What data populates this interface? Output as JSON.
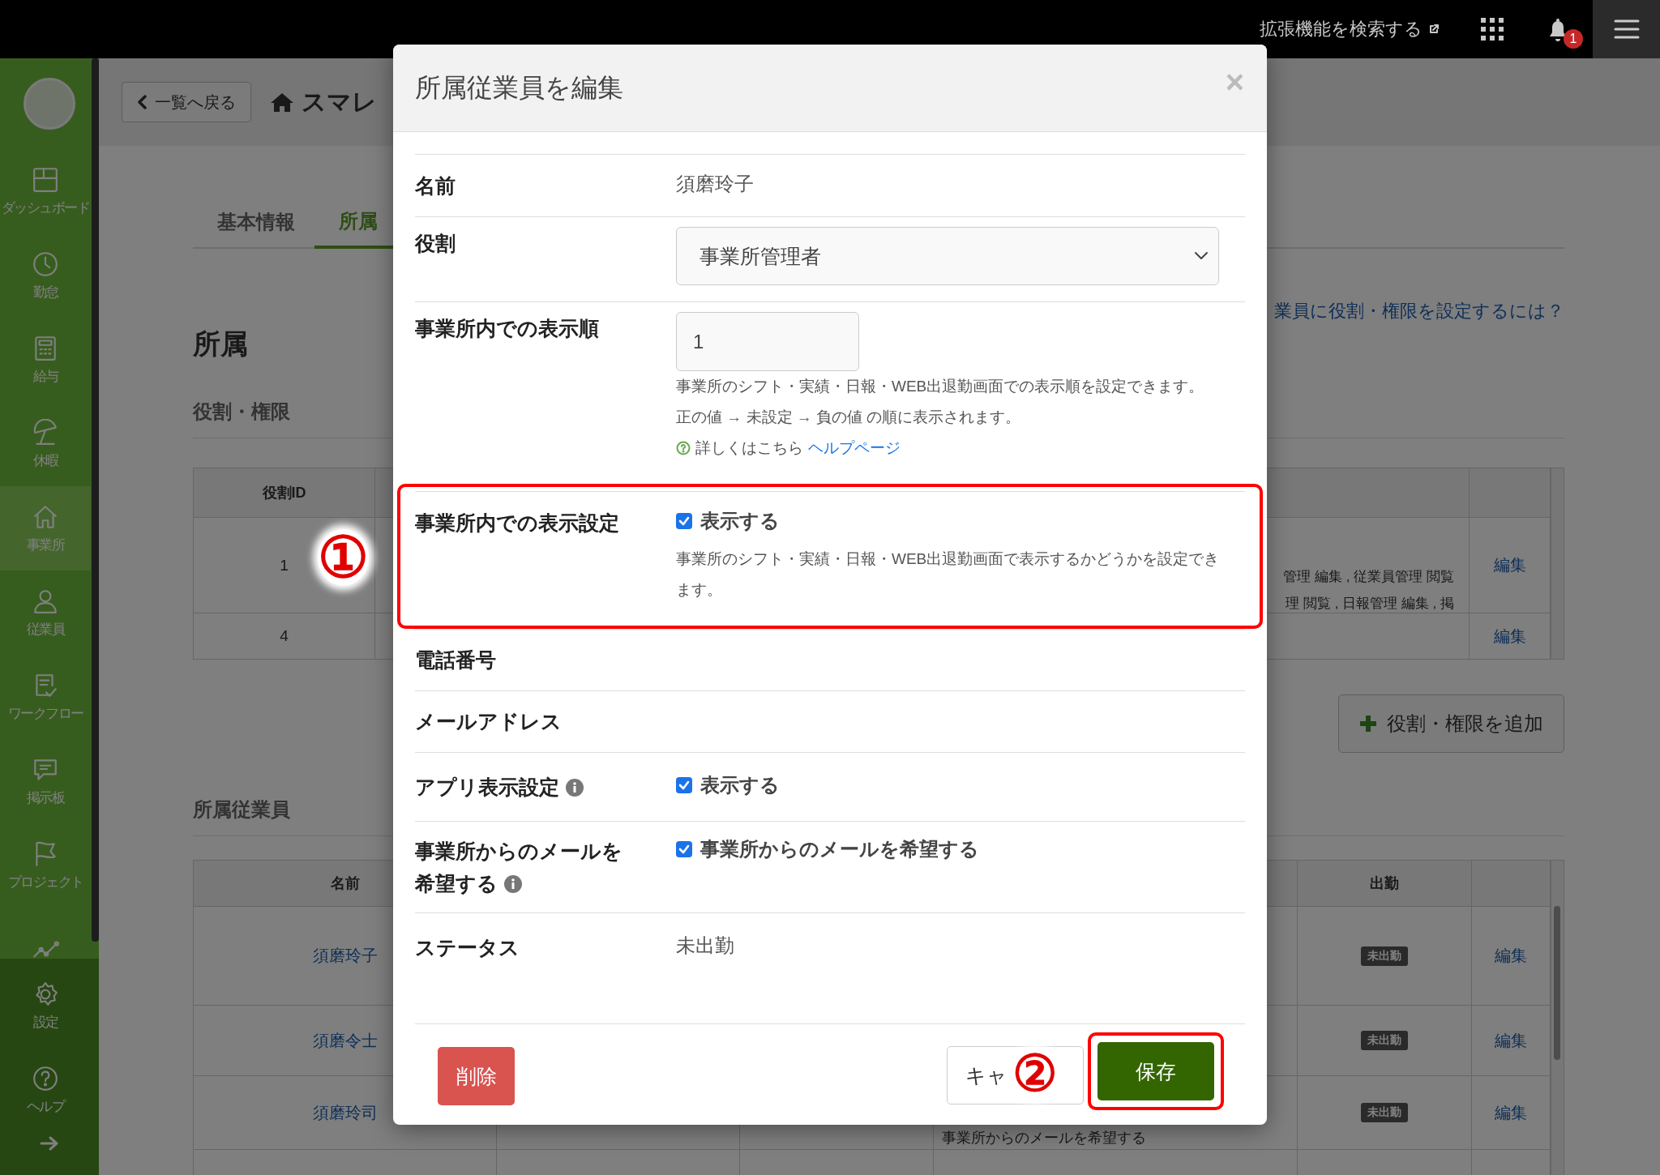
{
  "topbar": {
    "search_link": "拡張機能を検索する",
    "notification_count": "1"
  },
  "sidebar": {
    "items": [
      {
        "label": "ダッシュボード",
        "selected": false
      },
      {
        "label": "勤怠",
        "selected": false
      },
      {
        "label": "給与",
        "selected": false
      },
      {
        "label": "休暇",
        "selected": false
      },
      {
        "label": "事業所",
        "selected": true
      },
      {
        "label": "従業員",
        "selected": false
      },
      {
        "label": "ワークフロー",
        "selected": false
      },
      {
        "label": "掲示板",
        "selected": false
      },
      {
        "label": "プロジェクト",
        "selected": false
      },
      {
        "selected": false
      }
    ],
    "bottom_items": [
      {
        "label": "設定"
      },
      {
        "label": "ヘルプ"
      }
    ],
    "expand_arrow": true
  },
  "page": {
    "back_button": "一覧へ戻る",
    "title": "スマレ",
    "tabs": [
      {
        "label": "基本情報",
        "selected": false
      },
      {
        "label": "所属",
        "selected": true
      }
    ],
    "heading": "所属",
    "help_link": "業員に役割・権限を設定するには？",
    "roles": {
      "title": "役割・権限",
      "columns": [
        "役割ID"
      ],
      "rows": [
        {
          "id": "1",
          "permissions": [
            "管理 編集 , 従業員管理 閲覧",
            "理 閲覧 , 日報管理 編集 , 掲"
          ],
          "action": "編集"
        },
        {
          "id": "4",
          "action": "編集"
        }
      ]
    },
    "add_button": "役割・権限を追加",
    "staff": {
      "title": "所属従業員",
      "columns": [
        "名前",
        "出勤"
      ],
      "rows": [
        {
          "name": "須磨玲子",
          "status": "未出勤",
          "action": "編集"
        },
        {
          "name": "須磨令士",
          "status": "未出勤",
          "action": "編集"
        },
        {
          "name": "須磨玲司",
          "status": "未出勤",
          "action": "編集",
          "note": "事業所からのメールを希望する"
        }
      ]
    }
  },
  "modal": {
    "title": "所属従業員を編集",
    "close": "×",
    "fields": [
      {
        "kind": "text",
        "label": "名前",
        "value": "須磨玲子"
      },
      {
        "kind": "select",
        "label": "役割",
        "value": "事業所管理者"
      },
      {
        "kind": "number",
        "label": "事業所内での表示順",
        "value": "1",
        "help": [
          "事業所のシフト・実績・日報・WEB出退勤画面での表示順を設定できます。",
          "正の値 → 未設定 → 負の値 の順に表示されます。"
        ],
        "more": "詳しくはこちら",
        "link": "ヘルプページ"
      },
      {
        "kind": "checkbox",
        "label": "事業所内での表示設定",
        "checked": true,
        "option": "表示する",
        "help": [
          "事業所のシフト・実績・日報・WEB出退勤画面で表示するかどうかを設定できます。"
        ],
        "highlighted": true,
        "annotation": "①"
      },
      {
        "kind": "empty",
        "label": "電話番号"
      },
      {
        "kind": "empty",
        "label": "メールアドレス"
      },
      {
        "kind": "checkbox",
        "label": "アプリ表示設定",
        "info": true,
        "checked": true,
        "option": "表示する"
      },
      {
        "kind": "checkbox",
        "label": "事業所からのメールを希望する",
        "info": true,
        "checked": true,
        "option": "事業所からのメールを希望する"
      },
      {
        "kind": "text",
        "label": "ステータス",
        "value": "未出勤"
      }
    ],
    "buttons": [
      {
        "kind": "danger",
        "label": "削除"
      },
      {
        "kind": "default",
        "label": "キャ"
      },
      {
        "kind": "primary",
        "label": "保存",
        "highlighted": true,
        "annotation": "②"
      }
    ]
  }
}
